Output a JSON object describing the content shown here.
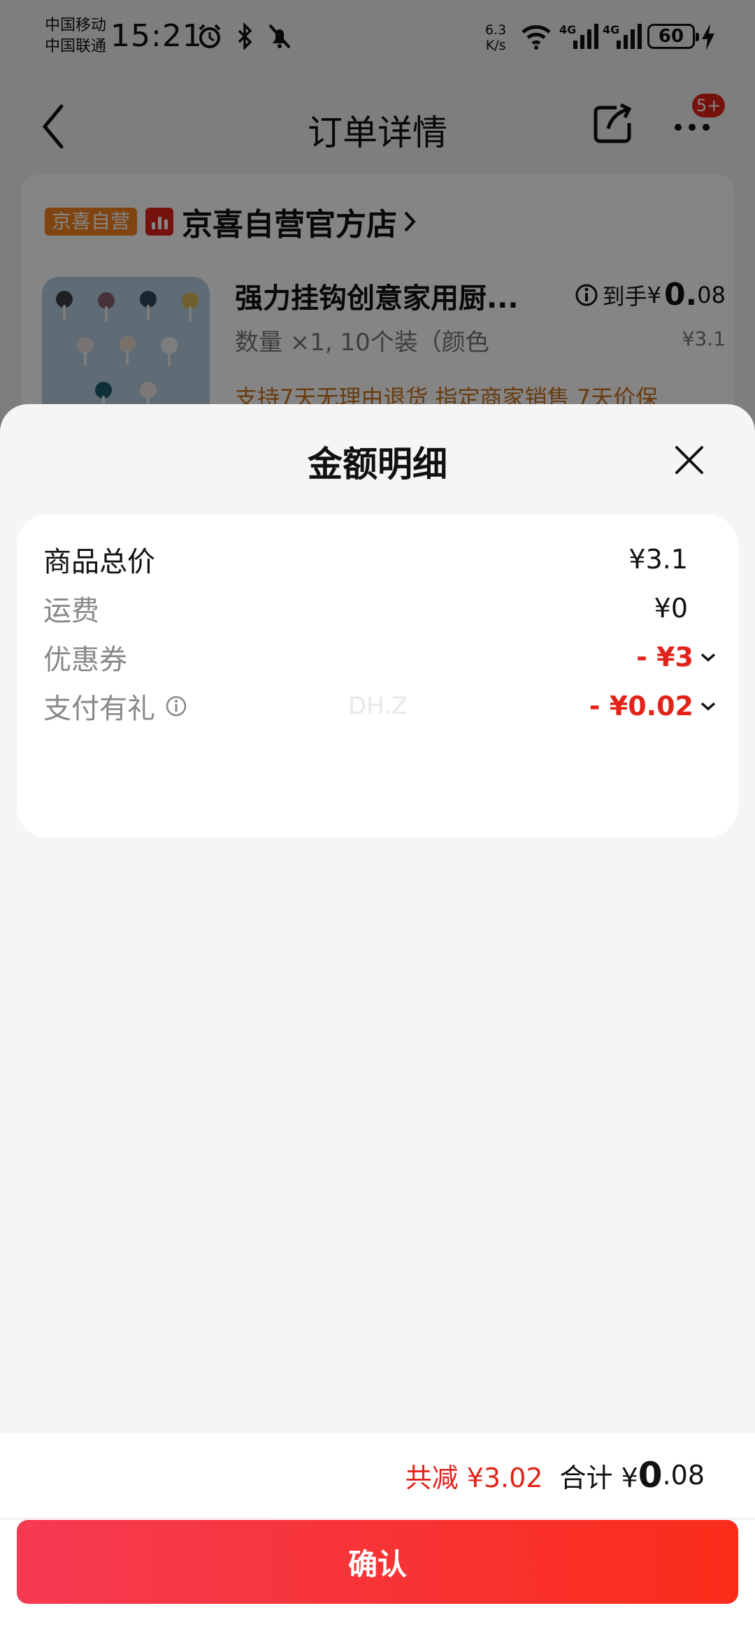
{
  "status_bar": {
    "carrier_1": "中国移动",
    "carrier_2": "中国联通",
    "time": "15:21",
    "net_speed_value": "6.3",
    "net_speed_unit": "K/s",
    "network_1": "4G",
    "network_2": "4G",
    "battery": "60",
    "icons": [
      "alarm-icon",
      "bluetooth-icon",
      "mute-icon",
      "wifi-icon",
      "signal-icon",
      "signal-icon",
      "battery-icon",
      "charging-icon"
    ]
  },
  "nav": {
    "title": "订单详情",
    "badge": "5+",
    "icons": [
      "back-icon",
      "share-icon",
      "more-icon"
    ]
  },
  "shop": {
    "self_tag": "京喜自营",
    "name": "京喜自营官方店",
    "product": {
      "title": "强力挂钩创意家用厨...",
      "price_prefix": "到手",
      "price_currency": "¥",
      "price_big": "0.",
      "price_small": "08",
      "spec": "数量 ×1, 10个装（颜色",
      "orig_price": "¥3.1",
      "service_tags": "支持7天无理由退货   指定商家销售   7天价保"
    }
  },
  "sheet": {
    "title": "金额明细",
    "rows": [
      {
        "label": "商品总价",
        "value": "¥3.1"
      },
      {
        "label": "运费",
        "value": "¥0"
      },
      {
        "label": "优惠券",
        "value": "- ¥3"
      },
      {
        "label": "支付有礼",
        "value": "- ¥0.02"
      }
    ],
    "watermark": "DH.Z",
    "summary": {
      "reduce": "共减 ¥3.02",
      "total_label": "合计 ¥",
      "total_big": "0",
      "total_small": ".08"
    },
    "confirm": "确认"
  },
  "colors": {
    "accent_red": "#e2231a",
    "confirm_gradient_start": "#f53a52",
    "confirm_gradient_end": "#fb2d1a",
    "self_tag": "#f5821f"
  }
}
